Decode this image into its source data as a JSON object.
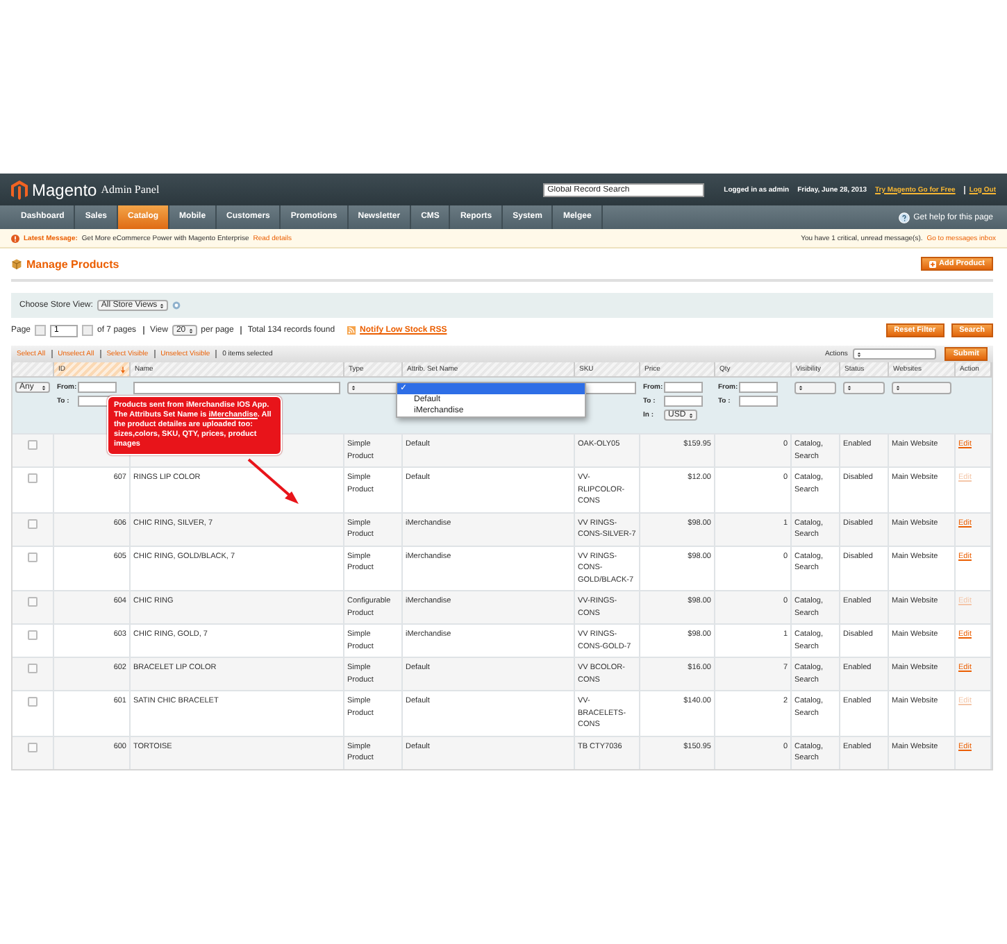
{
  "header": {
    "logo": "Magento",
    "subtitle": "Admin Panel",
    "search_placeholder": "Global Record Search",
    "user": "Logged in as admin",
    "date": "Friday, June 28, 2013",
    "links": [
      "Try Magento Go for Free",
      "Log Out"
    ]
  },
  "nav": [
    {
      "label": "Dashboard",
      "selected": false
    },
    {
      "label": "Sales",
      "selected": false
    },
    {
      "label": "Catalog",
      "selected": true
    },
    {
      "label": "Mobile",
      "selected": false
    },
    {
      "label": "Customers",
      "selected": false
    },
    {
      "label": "Promotions",
      "selected": false
    },
    {
      "label": "Newsletter",
      "selected": false
    },
    {
      "label": "CMS",
      "selected": false
    },
    {
      "label": "Reports",
      "selected": false
    },
    {
      "label": "System",
      "selected": false
    },
    {
      "label": "Melgee",
      "selected": false
    }
  ],
  "help": "Get help for this page",
  "message": {
    "label": "Latest Message:",
    "text": "Get More eCommerce Power with Magento Enterprise",
    "link": "Read details",
    "right_text": "You have 1 critical, unread message(s).",
    "right_link": "Go to messages inbox"
  },
  "page_title": "Manage Products",
  "add_button": "Add Product",
  "store_view": {
    "label": "Choose Store View:",
    "value": "All Store Views"
  },
  "pager": {
    "page_label": "Page",
    "page": "1",
    "of": "of 7 pages",
    "view_label": "View",
    "view": "20",
    "per_page": "per page",
    "total": "Total 134 records found",
    "rss": "Notify Low Stock RSS",
    "buttons": [
      "Reset Filter",
      "Search"
    ]
  },
  "massaction": {
    "links": [
      "Select All",
      "Unselect All",
      "Select Visible",
      "Unselect Visible"
    ],
    "count": "0 items selected",
    "actions_label": "Actions",
    "submit": "Submit"
  },
  "columns": [
    {
      "label": "ID",
      "sorted": true
    },
    {
      "label": "Name",
      "sorted": false
    },
    {
      "label": "Type",
      "sorted": false
    },
    {
      "label": "Attrib. Set Name",
      "sorted": false
    },
    {
      "label": "SKU",
      "sorted": false
    },
    {
      "label": "Price",
      "sorted": false
    },
    {
      "label": "Qty",
      "sorted": false
    },
    {
      "label": "Visibility",
      "sorted": false
    },
    {
      "label": "Status",
      "sorted": false
    },
    {
      "label": "Websites",
      "sorted": false
    },
    {
      "label": "Action",
      "sorted": false
    }
  ],
  "filters": {
    "any": "Any",
    "id": {
      "from": "From:",
      "to": "To :"
    },
    "price": {
      "from": "From:",
      "to": "To :",
      "in": "In :",
      "currency": "USD"
    },
    "qty": {
      "from": "From:",
      "to": "To :"
    }
  },
  "attr_dropdown": [
    {
      "label": "✓",
      "selected": true
    },
    {
      "label": "Default",
      "selected": false
    },
    {
      "label": "iMerchandise",
      "selected": false
    }
  ],
  "callout": "Products sent from iMerchandise IOS App. The Attributs Set Name is **iMerchandise**. All the product detailes are uploaded too: sizes,colors, SKU, QTY, prices, product images",
  "rows": [
    {
      "id": "",
      "name": "",
      "type": "Simple Product",
      "attr": "Default",
      "sku": "OAK-OLY05",
      "price": "$159.95",
      "qty": "0",
      "visibility": "Catalog, Search",
      "status": "Enabled",
      "website": "Main Website",
      "action": "Edit",
      "dim": false,
      "checked": false
    },
    {
      "id": "607",
      "name": "RINGS LIP COLOR",
      "type": "Simple Product",
      "attr": "Default",
      "sku": "VV-RLIPCOLOR-CONS",
      "price": "$12.00",
      "qty": "0",
      "visibility": "Catalog, Search",
      "status": "Disabled",
      "website": "Main Website",
      "action": "Edit",
      "dim": true,
      "checked": false
    },
    {
      "id": "606",
      "name": "CHIC RING, SILVER, 7",
      "type": "Simple Product",
      "attr": "iMerchandise",
      "sku": "VV RINGS-CONS-SILVER-7",
      "price": "$98.00",
      "qty": "1",
      "visibility": "Catalog, Search",
      "status": "Disabled",
      "website": "Main Website",
      "action": "Edit",
      "dim": false,
      "checked": false
    },
    {
      "id": "605",
      "name": "CHIC RING, GOLD/BLACK, 7",
      "type": "Simple Product",
      "attr": "iMerchandise",
      "sku": "VV RINGS-CONS-GOLD/BLACK-7",
      "price": "$98.00",
      "qty": "0",
      "visibility": "Catalog, Search",
      "status": "Disabled",
      "website": "Main Website",
      "action": "Edit",
      "dim": false,
      "checked": false
    },
    {
      "id": "604",
      "name": "CHIC RING",
      "type": "Configurable Product",
      "attr": "iMerchandise",
      "sku": "VV-RINGS-CONS",
      "price": "$98.00",
      "qty": "0",
      "visibility": "Catalog, Search",
      "status": "Enabled",
      "website": "Main Website",
      "action": "Edit",
      "dim": true,
      "checked": false
    },
    {
      "id": "603",
      "name": "CHIC RING, GOLD, 7",
      "type": "Simple Product",
      "attr": "iMerchandise",
      "sku": "VV RINGS-CONS-GOLD-7",
      "price": "$98.00",
      "qty": "1",
      "visibility": "Catalog, Search",
      "status": "Disabled",
      "website": "Main Website",
      "action": "Edit",
      "dim": false,
      "checked": false
    },
    {
      "id": "602",
      "name": "BRACELET LIP COLOR",
      "type": "Simple Product",
      "attr": "Default",
      "sku": "VV BCOLOR-CONS",
      "price": "$16.00",
      "qty": "7",
      "visibility": "Catalog, Search",
      "status": "Enabled",
      "website": "Main Website",
      "action": "Edit",
      "dim": false,
      "checked": false
    },
    {
      "id": "601",
      "name": "SATIN CHIC BRACELET",
      "type": "Simple Product",
      "attr": "Default",
      "sku": "VV-BRACELETS-CONS",
      "price": "$140.00",
      "qty": "2",
      "visibility": "Catalog, Search",
      "status": "Enabled",
      "website": "Main Website",
      "action": "Edit",
      "dim": true,
      "checked": false
    },
    {
      "id": "600",
      "name": "TORTOISE",
      "type": "Simple Product",
      "attr": "Default",
      "sku": "TB CTY7036",
      "price": "$150.95",
      "qty": "0",
      "visibility": "Catalog, Search",
      "status": "Enabled",
      "website": "Main Website",
      "action": "Edit",
      "dim": false,
      "checked": false
    }
  ]
}
